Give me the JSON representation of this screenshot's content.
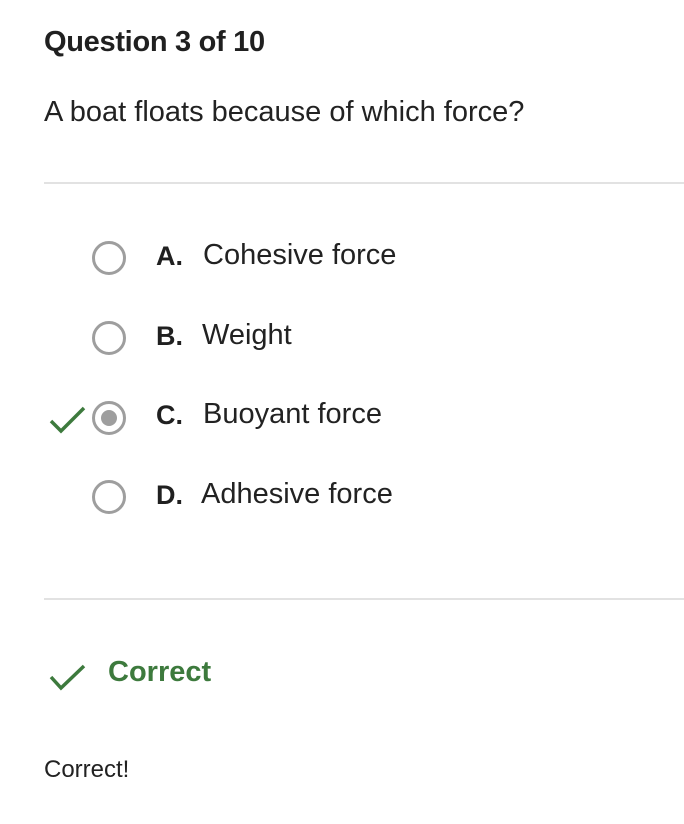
{
  "header": {
    "title": "Question 3 of 10"
  },
  "question": {
    "text": "A boat floats because of which force?"
  },
  "options": [
    {
      "letter": "A.",
      "text": "Cohesive force",
      "selected": false
    },
    {
      "letter": "B.",
      "text": "Weight",
      "selected": false
    },
    {
      "letter": "C.",
      "text": "Buoyant force",
      "selected": true,
      "marked_correct": true
    },
    {
      "letter": "D.",
      "text": "Adhesive force",
      "selected": false
    }
  ],
  "result": {
    "label": "Correct",
    "icon": "checkmark-icon",
    "color": "#3d7a3d"
  },
  "feedback": {
    "text": "Correct!"
  }
}
